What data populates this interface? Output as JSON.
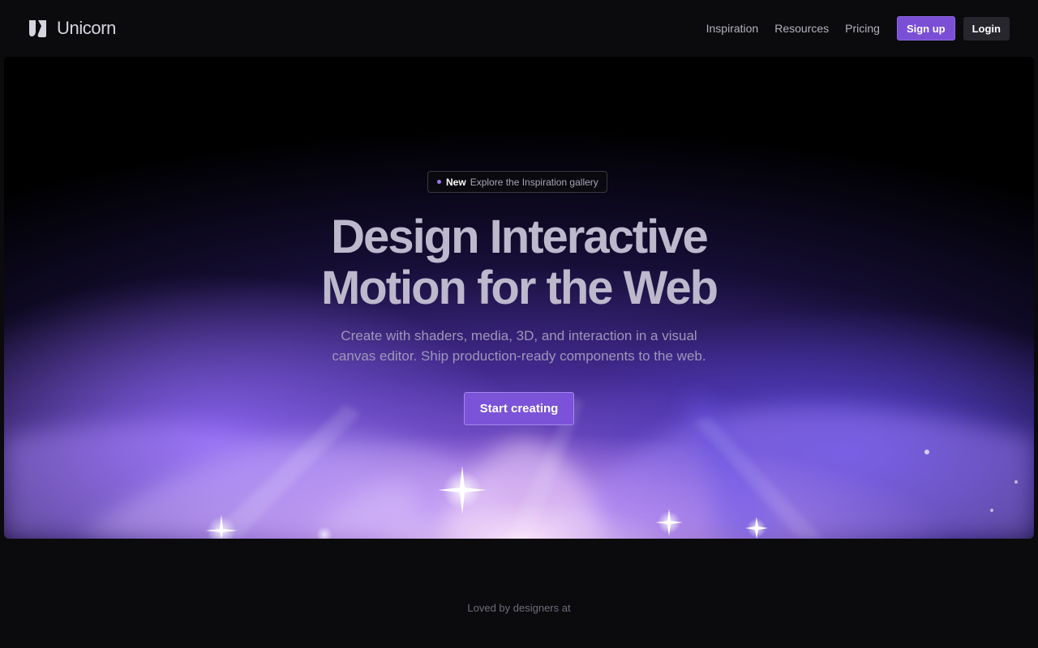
{
  "header": {
    "brand_name": "Unicorn",
    "logo_icon": "unicorn-logo-icon",
    "nav": [
      {
        "label": "Inspiration"
      },
      {
        "label": "Resources"
      },
      {
        "label": "Pricing"
      }
    ],
    "signup_label": "Sign up",
    "login_label": "Login"
  },
  "hero": {
    "badge": {
      "tag": "New",
      "text": "Explore the Inspiration gallery"
    },
    "headline_line1": "Design Interactive",
    "headline_line2": "Motion for the Web",
    "subtitle_line1": "Create with shaders, media, 3D, and interaction in a visual",
    "subtitle_line2": "canvas editor. Ship production-ready components to the web.",
    "cta_label": "Start creating"
  },
  "social_proof": {
    "label": "Loved by designers at"
  },
  "colors": {
    "accent": "#7a4fd6",
    "background": "#0b0b0e",
    "login_button": "#26262c"
  }
}
